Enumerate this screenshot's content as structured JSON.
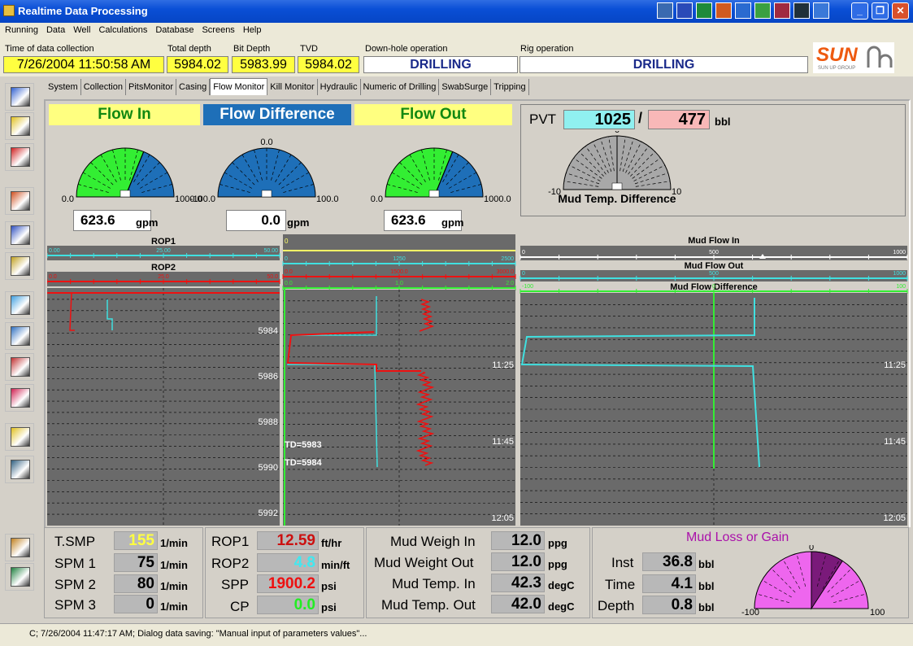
{
  "window": {
    "title": "Realtime Data Processing"
  },
  "menu": [
    "Running",
    "Data",
    "Well",
    "Calculations",
    "Database",
    "Screens",
    "Help"
  ],
  "header": {
    "time_label": "Time of data collection",
    "time_value": "7/26/2004 11:50:58 AM",
    "total_depth_label": "Total depth",
    "total_depth_value": "5984.02",
    "bit_depth_label": "Bit Depth",
    "bit_depth_value": "5983.99",
    "tvd_label": "TVD",
    "tvd_value": "5984.02",
    "downhole_label": "Down-hole operation",
    "downhole_value": "DRILLING",
    "rig_label": "Rig operation",
    "rig_value": "DRILLING",
    "logo_text": "SUN",
    "logo_sub": "SUN UP GROUP"
  },
  "tabs": [
    "System",
    "Collection",
    "PitsMonitor",
    "Casing",
    "Flow Monitor",
    "Kill Monitor",
    "Hydraulic",
    "Numeric of Drilling",
    "SwabSurge",
    "Tripping"
  ],
  "active_tab": 4,
  "gauges": {
    "flow_in": {
      "title": "Flow In",
      "min": "0.0",
      "max": "1000.0",
      "value": "623.6",
      "value_num": 623.6,
      "min_num": 0,
      "max_num": 1000,
      "unit": "gpm"
    },
    "flow_diff": {
      "title": "Flow Difference",
      "min": "-100.0",
      "max": "100.0",
      "top": "0.0",
      "value": "0.0",
      "value_num": 0,
      "min_num": -100,
      "max_num": 100,
      "unit": "gpm"
    },
    "flow_out": {
      "title": "Flow Out",
      "min": "0.0",
      "max": "1000.0",
      "value": "623.6",
      "value_num": 623.6,
      "min_num": 0,
      "max_num": 1000,
      "unit": "gpm"
    }
  },
  "pvt": {
    "label": "PVT",
    "value1": "1025",
    "sep": "/",
    "value2": "477",
    "unit": "bbl"
  },
  "mud_temp_gauge": {
    "title": "Mud Temp. Difference",
    "min": "-10",
    "max": "10",
    "top": "0"
  },
  "rop_tracks": {
    "rop1_title": "ROP1",
    "rop1_ticks": [
      "0.00",
      "25.00",
      "50.00"
    ],
    "rop2_title": "ROP2",
    "rop2_ticks": [
      "0.0",
      "25.0",
      "50.0"
    ],
    "depth_labels": [
      "5984",
      "5986",
      "5988",
      "5990",
      "5992"
    ]
  },
  "mid_track": {
    "top_tick": "0",
    "tick1": [
      "0",
      "1250",
      "2500"
    ],
    "tick2": [
      "0.0",
      "1500.0",
      "3000.0"
    ],
    "tick3": [
      "0.0",
      "1.0",
      "2.0"
    ],
    "times": [
      "11:25",
      "11:45",
      "12:05"
    ],
    "td1": "TD=5983",
    "td2": "TD=5984"
  },
  "right_track": {
    "mud_flow_in": "Mud Flow In",
    "mud_flow_out": "Mud Flow Out",
    "mud_flow_diff": "Mud Flow Difference",
    "in_ticks": [
      "0",
      "500",
      "1000"
    ],
    "out_ticks": [
      "0",
      "500",
      "1000"
    ],
    "diff_ticks": [
      "-100",
      "0",
      "100"
    ],
    "times": [
      "11:25",
      "11:45",
      "12:05"
    ]
  },
  "bottom": {
    "tsmp": {
      "label": "T.SMP",
      "value": "155",
      "unit": "1/min"
    },
    "spm1": {
      "label": "SPM 1",
      "value": "75",
      "unit": "1/min"
    },
    "spm2": {
      "label": "SPM 2",
      "value": "80",
      "unit": "1/min"
    },
    "spm3": {
      "label": "SPM 3",
      "value": "0",
      "unit": "1/min"
    },
    "rop1": {
      "label": "ROP1",
      "value": "12.59",
      "unit": "ft/hr"
    },
    "rop2": {
      "label": "ROP2",
      "value": "4.8",
      "unit": "min/ft"
    },
    "spp": {
      "label": "SPP",
      "value": "1900.2",
      "unit": "psi"
    },
    "cp": {
      "label": "CP",
      "value": "0.0",
      "unit": "psi"
    },
    "mw_in": {
      "label": "Mud Weigh In",
      "value": "12.0",
      "unit": "ppg"
    },
    "mw_out": {
      "label": "Mud Weight Out",
      "value": "12.0",
      "unit": "ppg"
    },
    "mt_in": {
      "label": "Mud Temp. In",
      "value": "42.3",
      "unit": "degC"
    },
    "mt_out": {
      "label": "Mud Temp. Out",
      "value": "42.0",
      "unit": "degC"
    }
  },
  "mud_loss": {
    "title": "Mud Loss or Gain",
    "inst": {
      "label": "Inst",
      "value": "36.8",
      "unit": "bbl"
    },
    "time": {
      "label": "Time",
      "value": "4.1",
      "unit": "bbl"
    },
    "depth": {
      "label": "Depth",
      "value": "0.8",
      "unit": "bbl"
    },
    "min": "-100",
    "max": "100",
    "top": "0"
  },
  "status": {
    "text": "C; 7/26/2004 11:47:17 AM;  Dialog data saving: \"Manual input of parameters values\"..."
  },
  "colors": {
    "green": "#33ee33",
    "blue": "#1e6fb8",
    "yellow": "#ffff66",
    "cyan": "#40e0e0",
    "red": "#ee1111",
    "magenta": "#ee66ee",
    "grid": "#6a6a6a"
  }
}
